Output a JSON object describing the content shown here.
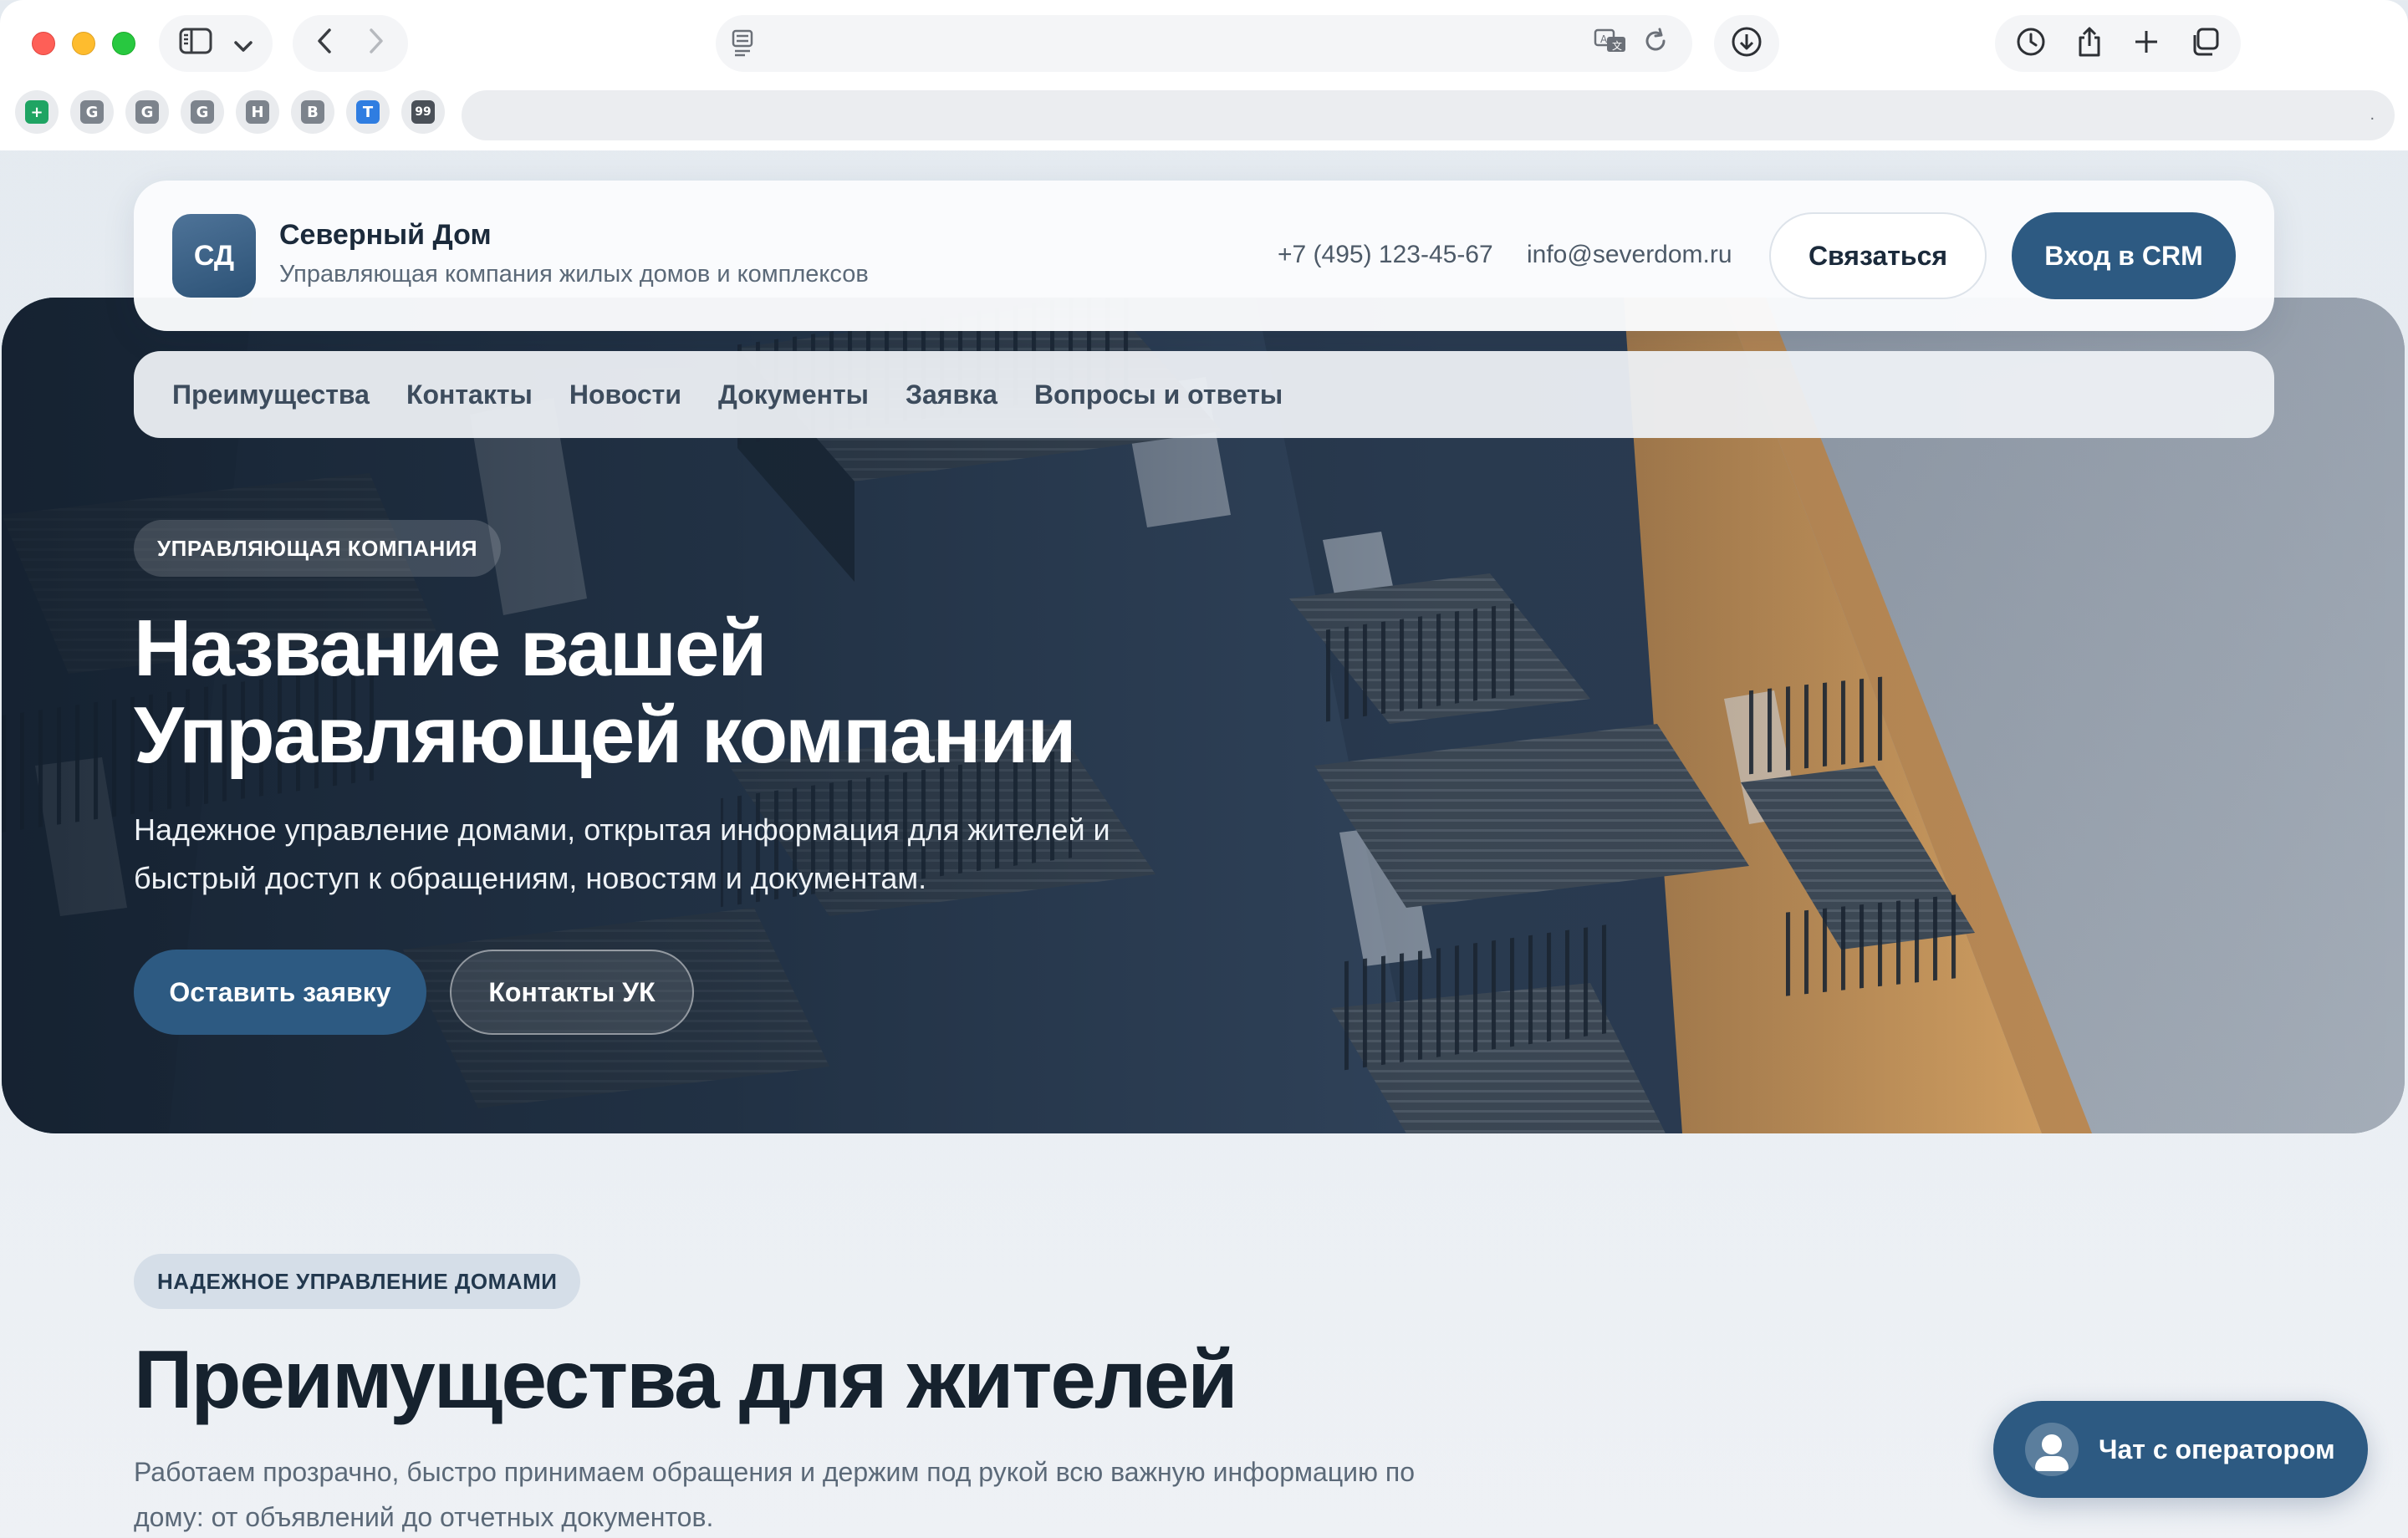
{
  "browser": {
    "favicons": [
      "",
      "G",
      "G",
      "G",
      "H",
      "B",
      "",
      "99"
    ],
    "icons": {
      "sidebar": "sidebar-icon",
      "chevron": "chevron-down-icon",
      "back": "back-arrow-icon",
      "forward": "forward-arrow-icon",
      "reader": "reader-icon",
      "translate": "translate-icon",
      "reload": "reload-icon",
      "download": "download-icon",
      "history": "history-icon",
      "share": "share-icon",
      "new_tab": "plus-icon",
      "tabs": "tabs-overview-icon"
    }
  },
  "header": {
    "logo_text": "СД",
    "brand_name": "Северный Дом",
    "brand_subtitle": "Управляющая компания жилых домов и комплексов",
    "phone": "+7 (495) 123-45-67",
    "email": "info@severdom.ru",
    "contact_button": "Связаться",
    "crm_button": "Вход в CRM"
  },
  "nav": {
    "items": [
      "Преимущества",
      "Контакты",
      "Новости",
      "Документы",
      "Заявка",
      "Вопросы и ответы"
    ]
  },
  "hero": {
    "badge": "УПРАВЛЯЮЩАЯ КОМПАНИЯ",
    "title_line1": "Название вашей",
    "title_line2": "Управляющей компании",
    "description": "Надежное управление домами, открытая информация для жителей и быстрый доступ к обращениям, новостям и документам.",
    "primary_button": "Оставить заявку",
    "secondary_button": "Контакты УК"
  },
  "benefits": {
    "badge": "НАДЕЖНОЕ УПРАВЛЕНИЕ ДОМАМИ",
    "title": "Преимущества для жителей",
    "description": "Работаем прозрачно, быстро принимаем обращения и держим под рукой всю важную информацию по дому: от объявлений до отчетных документов."
  },
  "chat": {
    "label": "Чат с оператором"
  },
  "colors": {
    "accent": "#2d5a82",
    "page_bg": "#e9eef3",
    "text_dark": "#16222e"
  }
}
